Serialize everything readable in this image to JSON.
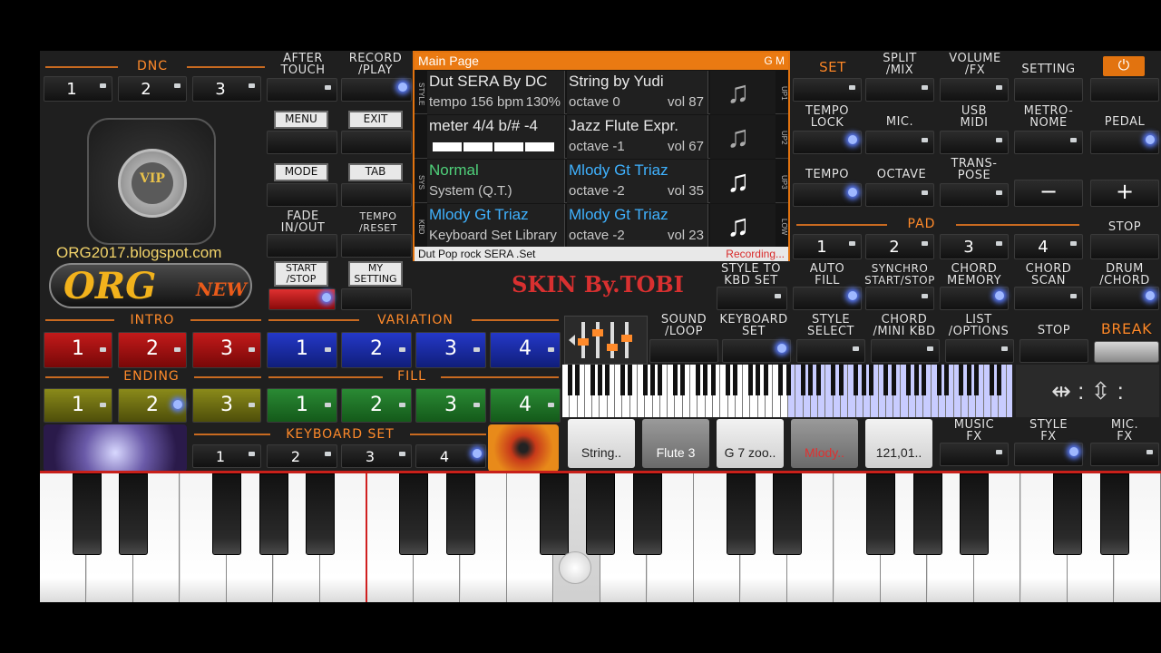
{
  "header_left": {
    "dnc_title": "DNC",
    "dnc_buttons": [
      "1",
      "2",
      "3"
    ],
    "after_touch": "AFTER\nTOUCH",
    "record_play": "RECORD\n/PLAY",
    "menu": "MENU",
    "exit": "EXIT",
    "mode": "MODE",
    "tab": "TAB",
    "fade": "FADE\nIN/OUT",
    "tempo_reset": "TEMPO\n/RESET",
    "start_stop": "START\n/STOP",
    "my_setting": "MY\nSETTING",
    "vip": "VIP",
    "blog": "ORG2017.blogspot.com",
    "logo_main": "ORG",
    "logo_new": "NEW"
  },
  "main_page": {
    "title": "Main Page",
    "gm": "G M",
    "rows": [
      {
        "side": "STYLE",
        "c1_top": "Dut SERA By DC",
        "c1_bottom_left": "tempo 156 bpm",
        "c1_bottom_right": "130%",
        "c2_top": "String by Yudi",
        "c2_bottom_left": "octave  0",
        "c2_bottom_right": "vol 87",
        "right": "UP1"
      },
      {
        "side": "",
        "c1_top": "meter 4/4 b/# -4",
        "c2_top": "Jazz Flute Expr.",
        "c2_bottom_left": "octave -1",
        "c2_bottom_right": "vol 67",
        "right": "UP2"
      },
      {
        "side": "SYS",
        "c1_top": "Normal",
        "c1_bottom_left": "System (Q.T.)",
        "c2_top": "Mlody Gt Triaz",
        "c2_bottom_left": "octave -2",
        "c2_bottom_right": "vol 35",
        "right": "UP3"
      },
      {
        "side": "KBD",
        "c1_top": "Mlody Gt Triaz",
        "c1_bottom_left": "Keyboard Set Library",
        "c2_top": "Mlody Gt Triaz",
        "c2_bottom_left": "octave -2",
        "c2_bottom_right": "vol 23",
        "right": "LOW"
      }
    ],
    "footer": "Dut Pop rock SERA .Set",
    "recording": "Recording..."
  },
  "skin_label": "SKIN By.TOBI",
  "right_panel": {
    "set": "SET",
    "split_mix": "SPLIT\n/MIX",
    "volume_fx": "VOLUME\n/FX",
    "setting": "SETTING",
    "tempo_lock": "TEMPO\nLOCK",
    "mic": "MIC.",
    "usb_midi": "USB\nMIDI",
    "metronome": "METRO-\nNOME",
    "pedal": "PEDAL",
    "tempo": "TEMPO",
    "octave": "OCTAVE",
    "transpose": "TRANS-\nPOSE",
    "minus": "−",
    "plus": "+",
    "pad_title": "PAD",
    "stop": "STOP",
    "pad_buttons": [
      "1",
      "2",
      "3",
      "4"
    ],
    "style_to_kbd": "STYLE TO\nKBD SET",
    "auto_fill": "AUTO\nFILL",
    "synchro": "SYNCHRO\nSTART/STOP",
    "chord_memory": "CHORD\nMEMORY",
    "chord_scan": "CHORD\nSCAN",
    "drum_chord": "DRUM\n/CHORD",
    "sound_loop": "SOUND\n/LOOP",
    "keyboard_set": "KEYBOARD\nSET",
    "style_select": "STYLE\nSELECT",
    "chord_mini": "CHORD\n/MINI KBD",
    "list_options": "LIST\n/OPTIONS",
    "stop2": "STOP",
    "break": "BREAK",
    "music_fx": "MUSIC\nFX",
    "style_fx": "STYLE\nFX",
    "mic_fx": "MIC.\nFX"
  },
  "intro": {
    "title": "INTRO",
    "buttons": [
      "1",
      "2",
      "3"
    ]
  },
  "variation": {
    "title": "VARIATION",
    "buttons": [
      "1",
      "2",
      "3",
      "4"
    ]
  },
  "ending": {
    "title": "ENDING",
    "buttons": [
      "1",
      "2",
      "3"
    ]
  },
  "fill": {
    "title": "FILL",
    "buttons": [
      "1",
      "2",
      "3",
      "4"
    ]
  },
  "keyboard_set": {
    "title": "KEYBOARD SET",
    "buttons": [
      "1",
      "2",
      "3",
      "4"
    ]
  },
  "sound_chips": [
    "String..",
    "Flute 3",
    "G 7 zoo..",
    "Mlody..",
    "121,01.."
  ],
  "colors": {
    "accent": "#e2730f",
    "red_pad": "#b01515",
    "blue_pad": "#1a2ea8",
    "yellow_pad": "#7a7a18",
    "green_pad": "#1f7a2a",
    "cyan_text": "#3fb2ff",
    "green_text": "#4fd07a",
    "recording": "#d92a2a"
  }
}
